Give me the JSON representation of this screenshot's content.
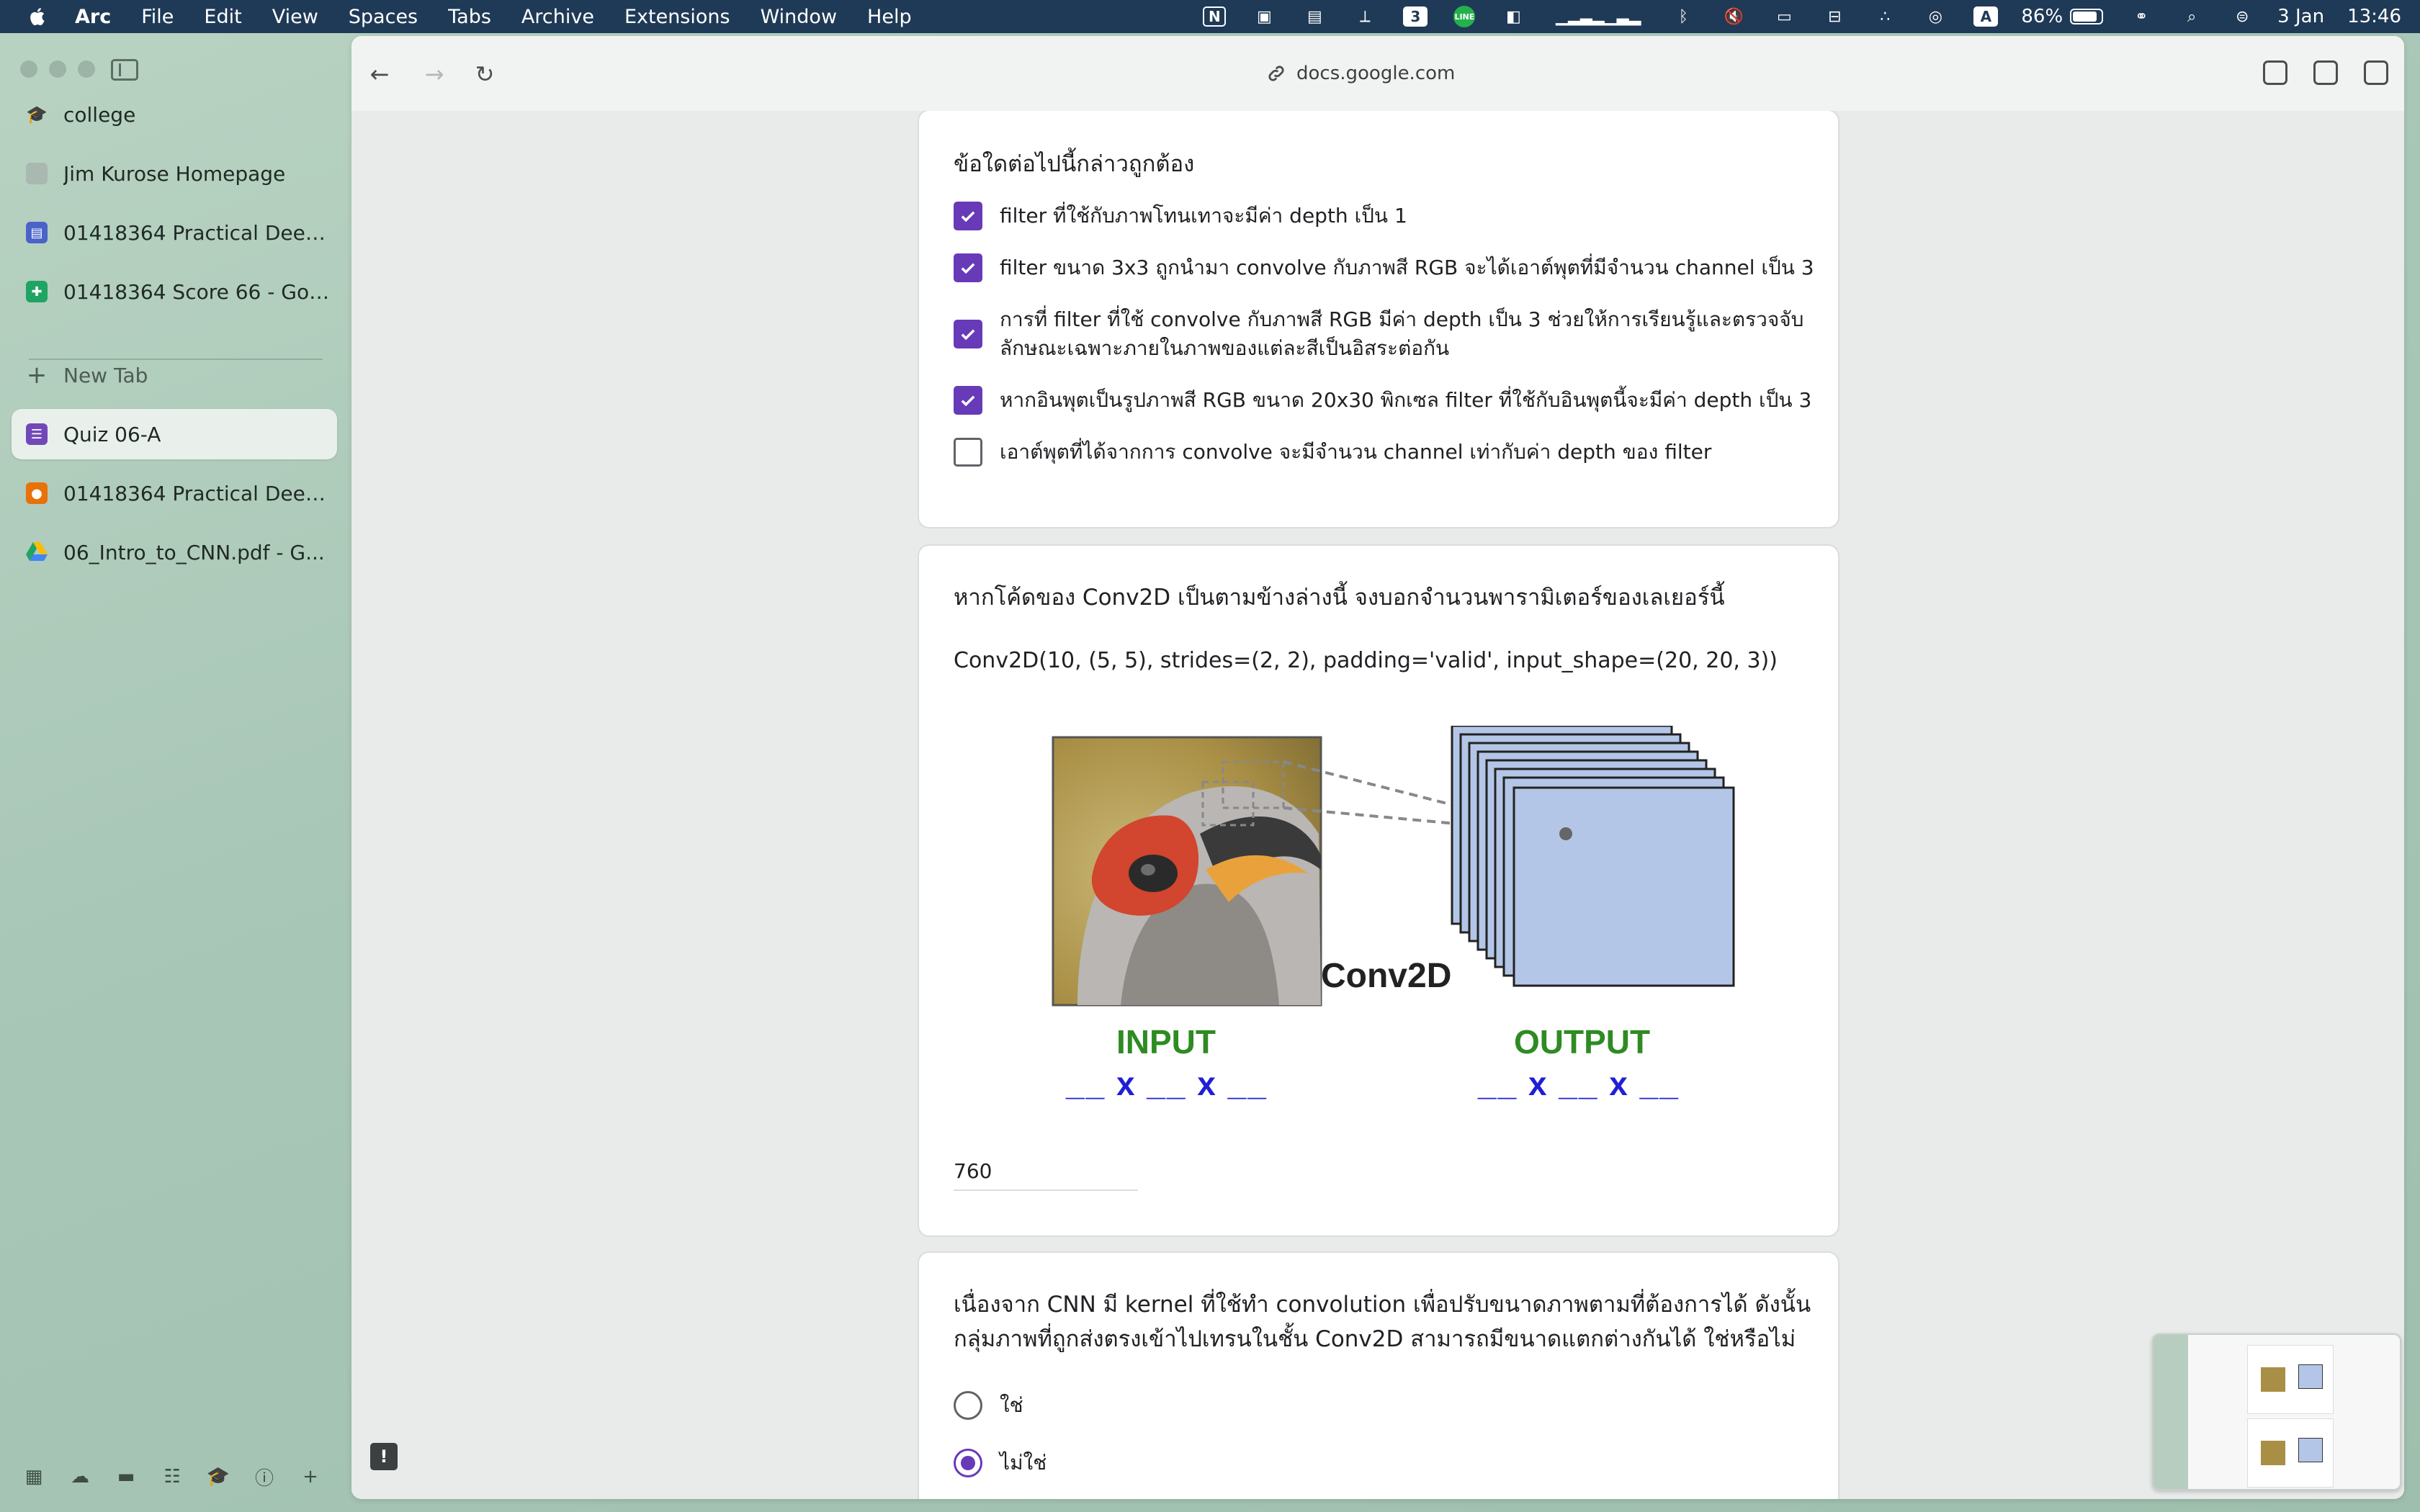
{
  "menubar": {
    "app": "Arc",
    "items": [
      "File",
      "Edit",
      "View",
      "Spaces",
      "Tabs",
      "Archive",
      "Extensions",
      "Window",
      "Help"
    ],
    "status": {
      "badge_number": "3",
      "line_label": "LINE",
      "input_source": "A",
      "battery": "86%",
      "battery_level": 0.86,
      "date": "3 Jan",
      "time": "13:46"
    }
  },
  "sidebar": {
    "pinned": [
      {
        "label": "college",
        "icon": "graduation-cap-icon"
      },
      {
        "label": "Jim Kurose Homepage",
        "icon": "page-icon"
      },
      {
        "label": "01418364 Practical Deep...",
        "icon": "classroom-icon"
      },
      {
        "label": "01418364 Score 66 - Goo...",
        "icon": "sheets-icon"
      }
    ],
    "new_tab": "New Tab",
    "tabs": [
      {
        "label": "Quiz 06-A",
        "icon": "forms-icon",
        "active": true
      },
      {
        "label": "01418364 Practical Deep...",
        "icon": "classroom-icon",
        "active": false
      },
      {
        "label": "06_Intro_to_CNN.pdf - G...",
        "icon": "drive-icon",
        "active": false
      }
    ]
  },
  "browser": {
    "url": "docs.google.com"
  },
  "quiz": {
    "q1": {
      "title": "ข้อใดต่อไปนี้กล่าวถูกต้อง",
      "options": [
        {
          "text": "filter ที่ใช้กับภาพโทนเทาจะมีค่า depth เป็น 1",
          "checked": true
        },
        {
          "text": "filter ขนาด 3x3 ถูกนำมา convolve กับภาพสี RGB จะได้เอาต์พุตที่มีจำนวน channel เป็น 3",
          "checked": true
        },
        {
          "text": "การที่ filter ที่ใช้ convolve กับภาพสี RGB มีค่า depth เป็น 3 ช่วยให้การเรียนรู้และตรวจจับลักษณะเฉพาะภายในภาพของแต่ละสีเป็นอิสระต่อกัน",
          "checked": true
        },
        {
          "text": "หากอินพุตเป็นรูปภาพสี RGB ขนาด 20x30 พิกเซล filter ที่ใช้กับอินพุตนี้จะมีค่า depth เป็น 3",
          "checked": true
        },
        {
          "text": "เอาต์พุตที่ได้จากการ convolve จะมีจำนวน channel เท่ากับค่า depth ของ filter",
          "checked": false
        }
      ]
    },
    "q2": {
      "title": "หากโค้ดของ Conv2D เป็นตามข้างล่างนี้ จงบอกจำนวนพารามิเตอร์ของเลเยอร์นี้",
      "code": "Conv2D(10, (5, 5), strides=(2, 2), padding='valid', input_shape=(20, 20, 3))",
      "diagram": {
        "input_label": "INPUT",
        "output_label": "OUTPUT",
        "layer_label": "Conv2D",
        "input_dims": "__ x __ x __",
        "output_dims": "__ x __ x __"
      },
      "answer": "760"
    },
    "q3": {
      "title_line1": "เนื่องจาก CNN มี kernel ที่ใช้ทำ convolution เพื่อปรับขนาดภาพตามที่ต้องการได้ ดังนั้น",
      "title_line2": "กลุ่มภาพที่ถูกส่งตรงเข้าไปเทรนในชั้น Conv2D  สามารถมีขนาดแตกต่างกันได้ ใช่หรือไม่",
      "options": [
        {
          "text": "ใช่",
          "selected": false
        },
        {
          "text": "ไม่ใช่",
          "selected": true
        }
      ]
    }
  },
  "colors": {
    "accent": "#673ab7",
    "menubar": "#1f3a56",
    "input_output_label": "#2e8b22",
    "dims": "#1f1fd6",
    "feature_map": "#b4c6e7"
  }
}
